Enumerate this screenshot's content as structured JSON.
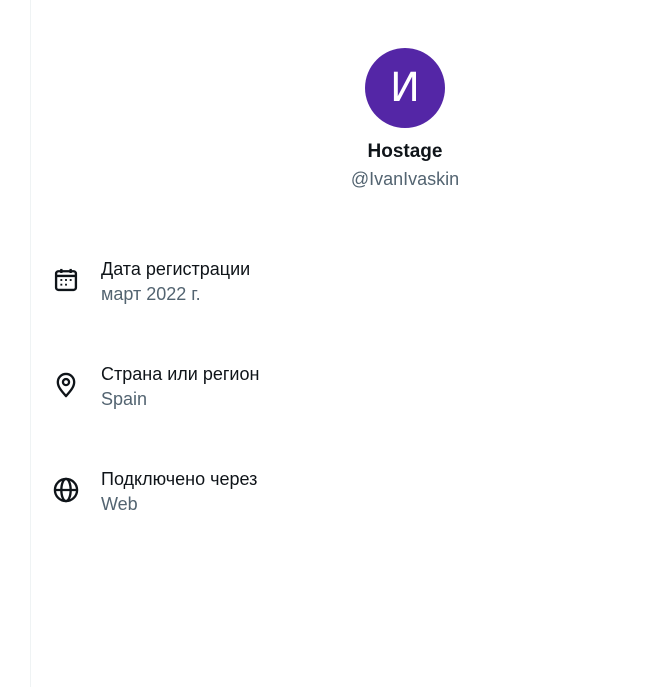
{
  "colors": {
    "avatar_bg": "#5426a6",
    "text_primary": "#0f1419",
    "text_secondary": "#536471"
  },
  "profile": {
    "avatar_initial": "И",
    "display_name": "Hostage",
    "handle": "@IvanIvaskin"
  },
  "info": [
    {
      "icon": "calendar-icon",
      "label": "Дата регистрации",
      "value": "март 2022 г."
    },
    {
      "icon": "location-pin-icon",
      "label": "Страна или регион",
      "value": "Spain"
    },
    {
      "icon": "globe-icon",
      "label": "Подключено через",
      "value": "Web"
    }
  ]
}
